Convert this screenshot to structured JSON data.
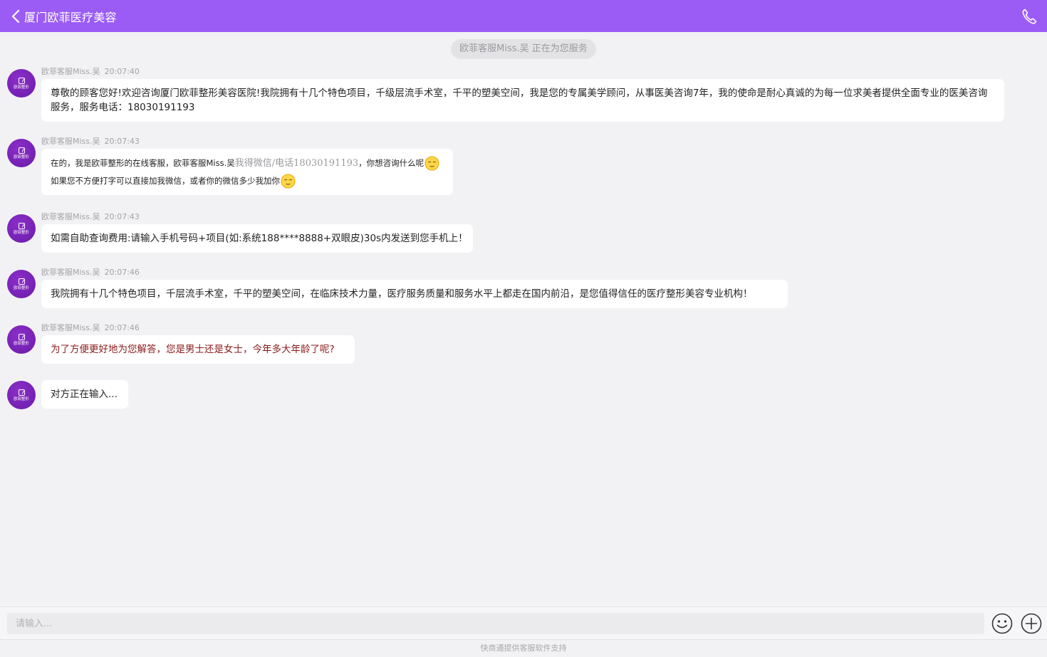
{
  "header": {
    "title": "厦门欧菲医疗美容",
    "back_icon": "chevron-left-icon",
    "call_icon": "phone-icon",
    "bar_color": "#9b5cf6"
  },
  "system_notice": "欧菲客服Miss.吴 正在为您服务",
  "avatar": {
    "logo_text": "欧菲整形",
    "color": "#7a22b8"
  },
  "messages": [
    {
      "sender": "欧菲客服Miss.吴",
      "time": "20:07:40",
      "text": " 尊敬的顾客您好!欢迎咨询厦门欧菲整形美容医院!我院拥有十几个特色项目，千级层流手术室，千平的塑美空间，我是您的专属美学顾问，从事医美咨询7年，我的使命是耐心真诚的为每一位求美者提供全面专业的医美咨询服务，服务电话：18030191193"
    },
    {
      "sender": "欧菲客服Miss.吴",
      "time": "20:07:43",
      "line1_a": "在的，我是欧菲整形的在线客服，欧菲客服Miss.吴",
      "line1_grey": "我得微信/电话18030191193",
      "line1_b": "，你想咨询什么呢",
      "line2": "如果您不方便打字可以直接加我微信，或者你的微信多少我加你",
      "emoji_icon": "smiley-emoji-icon"
    },
    {
      "sender": "欧菲客服Miss.吴",
      "time": "20:07:43",
      "text": "如需自助查询费用:请输入手机号码+项目(如:系统188****8888+双眼皮)30s内发送到您手机上！"
    },
    {
      "sender": "欧菲客服Miss.吴",
      "time": "20:07:46",
      "text": "我院拥有十几个特色项目，千层流手术室，千平的塑美空间，在临床技术力量，医疗服务质量和服务水平上都走在国内前沿，是您值得信任的医疗整形美容专业机构！"
    },
    {
      "sender": "欧菲客服Miss.吴",
      "time": "20:07:46",
      "text": "为了方便更好地为您解答，您是男士还是女士，今年多大年龄了呢?",
      "text_color": "#8b1a1a"
    }
  ],
  "typing_text": "对方正在输入...",
  "composer": {
    "placeholder": "请输入...",
    "emoji_icon": "emoji-picker-icon",
    "plus_icon": "plus-circle-icon"
  },
  "footer_text": "快商通提供客服软件支持"
}
